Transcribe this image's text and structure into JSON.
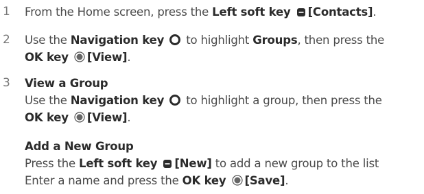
{
  "steps": [
    {
      "number": "1",
      "line1": {
        "text_a": "From the Home screen, press the ",
        "key_name": "Left soft key",
        "bracket": "[Contacts]",
        "end": "."
      }
    },
    {
      "number": "2",
      "line1": {
        "text_a": "Use the ",
        "key_name": "Navigation key",
        "text_b": " to highlight ",
        "target": "Groups",
        "text_c": ", then press the"
      },
      "line2": {
        "key_name": "OK key",
        "bracket": "[View]",
        "end": "."
      }
    },
    {
      "number": "3",
      "heading": "View a Group",
      "line1": {
        "text_a": "Use the ",
        "key_name": "Navigation key",
        "text_b": " to highlight a group, then press the"
      },
      "line2": {
        "key_name": "OK key",
        "bracket": "[View]",
        "end": "."
      },
      "sub_heading": "Add a New Group",
      "line3": {
        "text_a": "Press the ",
        "key_name": "Left soft key",
        "bracket": "[New]",
        "text_b": " to add a new group to the list"
      },
      "line4": {
        "text_a": "Enter a name and press the ",
        "key_name": "OK key",
        "bracket": "[Save]",
        "end": "."
      }
    }
  ],
  "icons": [
    "left-soft-key-icon",
    "navigation-key-icon",
    "ok-key-icon"
  ]
}
